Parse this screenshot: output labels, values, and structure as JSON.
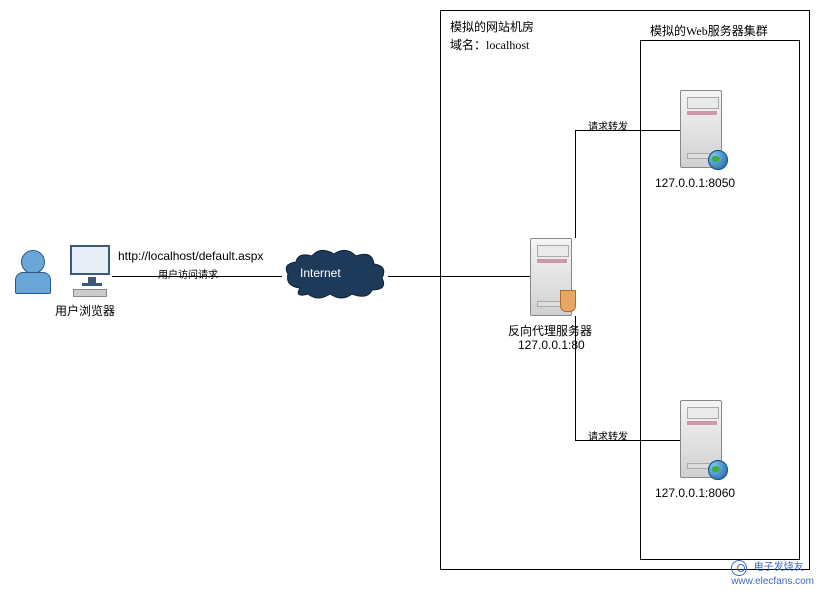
{
  "client": {
    "url": "http://localhost/default.aspx",
    "request_label": "用户访问请求",
    "browser_label": "用户浏览器"
  },
  "internet": {
    "label": "Internet"
  },
  "room": {
    "title1": "模拟的网站机房",
    "title2": "域名：localhost"
  },
  "cluster": {
    "title": "模拟的Web服务器集群"
  },
  "proxy": {
    "label1": "反向代理服务器",
    "label2": "127.0.0.1:80",
    "forward_label1": "请求转发",
    "forward_label2": "请求转发"
  },
  "web1": {
    "addr": "127.0.0.1:8050"
  },
  "web2": {
    "addr": "127.0.0.1:8060"
  },
  "watermark": {
    "text": "电子发烧友",
    "url": "www.elecfans.com"
  }
}
